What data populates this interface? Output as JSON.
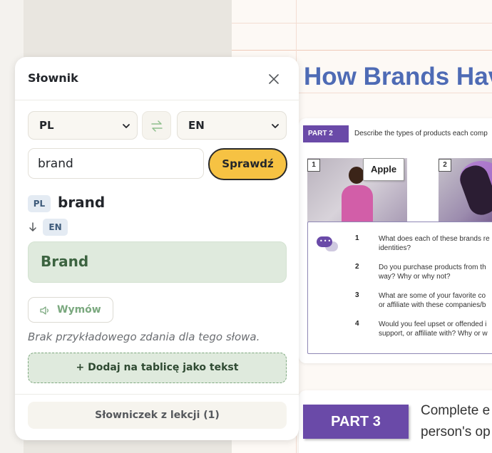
{
  "slide": {
    "title": "How Brands Hav",
    "part2_label": "PART 2",
    "part2_text": "Describe the types of products each comp",
    "photo1_number": "1",
    "photo1_label": "Apple",
    "photo2_number": "2",
    "questions": [
      {
        "num": "1",
        "text": "What does each of these brands re\nidentities?"
      },
      {
        "num": "2",
        "text": "Do you purchase products from th\nway? Why or why not?"
      },
      {
        "num": "3",
        "text": "What are some of your favorite co\nor affiliate with these companies/b"
      },
      {
        "num": "4",
        "text": "Would you feel upset or offended i\nsupport, or affiliate with? Why or w"
      }
    ],
    "part3_label": "PART 3",
    "part3_text": "Complete e\nperson's op"
  },
  "dictionary": {
    "title": "Słownik",
    "from_lang": "PL",
    "to_lang": "EN",
    "search_value": "brand",
    "check_label": "Sprawdź",
    "source_tag": "PL",
    "source_word": "brand",
    "target_tag": "EN",
    "translation": "Brand",
    "speak_label": "Wymów",
    "no_example": "Brak przykładowego zdania dla tego słowa.",
    "add_label": "+ Dodaj na tablicę jako tekst",
    "glossary_label": "Słowniczek z lekcji (1)"
  },
  "colors": {
    "accent_yellow": "#f6c243",
    "accent_green": "#dfeadd",
    "slide_title_blue": "#4e6bb5",
    "part_purple": "#6a4aa8"
  }
}
